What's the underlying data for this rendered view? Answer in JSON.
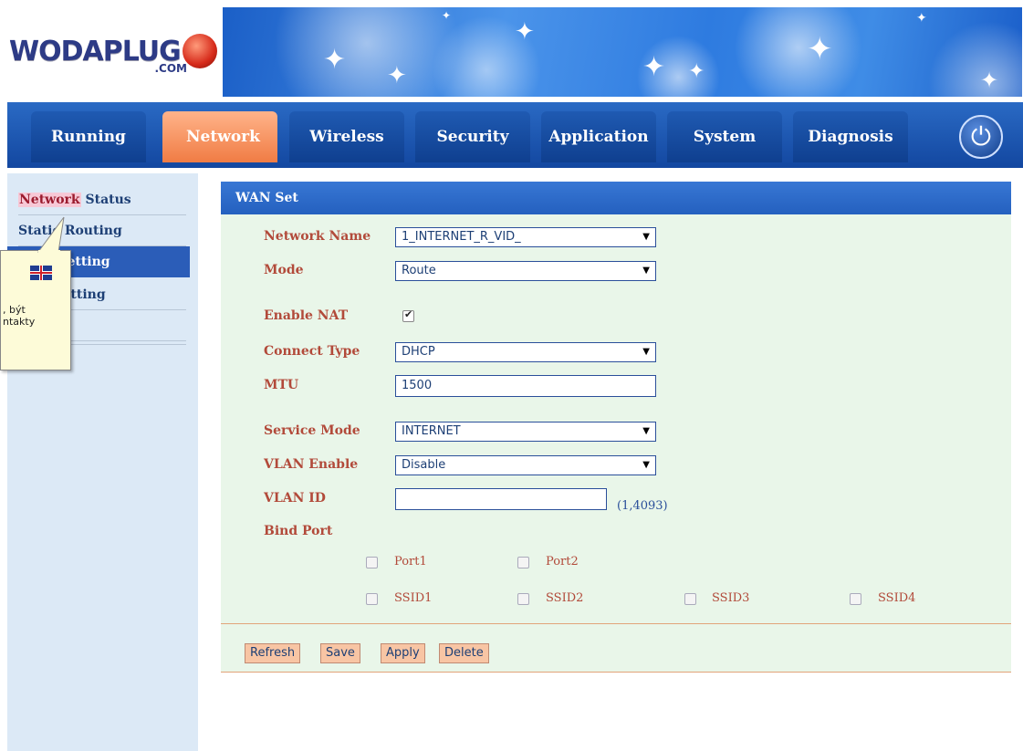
{
  "logo": {
    "text": "WODAPLUG",
    "sub": ".COM"
  },
  "nav": {
    "tabs": [
      "Running",
      "Network",
      "Wireless",
      "Security",
      "Application",
      "System",
      "Diagnosis"
    ],
    "active": "Network"
  },
  "sidebar": {
    "items": [
      {
        "part1": "Network",
        "part2": " Status"
      },
      {
        "label": "Static Routing"
      },
      {
        "label": "WAN Setting"
      },
      {
        "label": "LAN Setting"
      },
      {
        "label": ""
      },
      {
        "label": ""
      }
    ]
  },
  "tooltip": {
    "line1": ", být",
    "line2": "ntakty"
  },
  "panel": {
    "title": "WAN Set",
    "labels": {
      "network_name": "Network Name",
      "mode": "Mode",
      "enable_nat": "Enable NAT",
      "connect_type": "Connect Type",
      "mtu": "MTU",
      "service_mode": "Service Mode",
      "vlan_enable": "VLAN Enable",
      "vlan_id": "VLAN ID",
      "bind_port": "Bind Port"
    },
    "values": {
      "network_name": "1_INTERNET_R_VID_",
      "mode": "Route",
      "enable_nat": true,
      "connect_type": "DHCP",
      "mtu": "1500",
      "service_mode": "INTERNET",
      "vlan_enable": "Disable",
      "vlan_id": "",
      "vlan_range": "(1,4093)"
    },
    "ports": [
      "Port1",
      "Port2"
    ],
    "ssids": [
      "SSID1",
      "SSID2",
      "SSID3",
      "SSID4"
    ],
    "buttons": {
      "refresh": "Refresh",
      "save": "Save",
      "apply": "Apply",
      "delete": "Delete"
    }
  },
  "colors": {
    "nav_blue": "#1347a0",
    "active_tab": "#f07c44",
    "label_red": "#b24a3a",
    "panel_bg": "#e9f6e9"
  }
}
